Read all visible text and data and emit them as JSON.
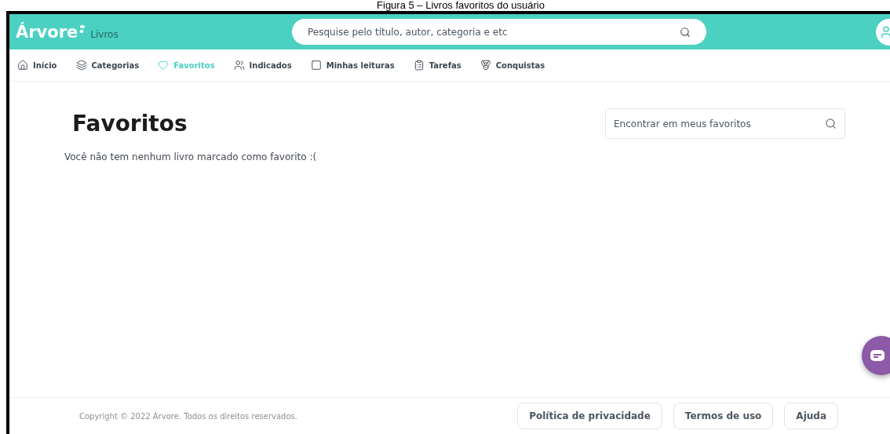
{
  "caption": "Figura 5 – Livros favoritos do usuário",
  "header": {
    "logo": "Árvore",
    "logo_suffix": "Livros",
    "search": {
      "placeholder": "Pesquise pelo título, autor, categoria e etc"
    }
  },
  "nav": [
    {
      "label": "Início",
      "selected": false
    },
    {
      "label": "Categorias",
      "selected": false
    },
    {
      "label": "Favoritos",
      "selected": true
    },
    {
      "label": "Indicados",
      "selected": false
    },
    {
      "label": "Minhas leituras",
      "selected": false
    },
    {
      "label": "Tarefas",
      "selected": false
    },
    {
      "label": "Conquistas",
      "selected": false
    }
  ],
  "page": {
    "title": "Favoritos",
    "search": {
      "placeholder": "Encontrar em meus favoritos"
    },
    "empty_message": "Você não tem nenhum livro marcado como favorito :("
  },
  "footer": {
    "copyright": "Copyright © 2022 Árvore. Todos os direitos reservados.",
    "links": [
      "Política de privacidade",
      "Termos de uso",
      "Ajuda"
    ]
  }
}
